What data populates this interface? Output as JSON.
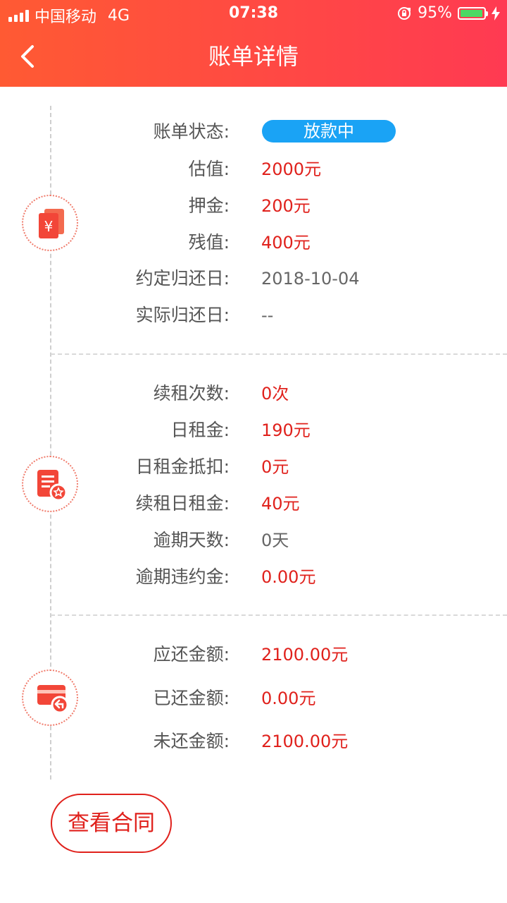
{
  "status_bar": {
    "carrier": "中国移动",
    "network": "4G",
    "time": "07:38",
    "battery_percent": "95%"
  },
  "nav": {
    "title": "账单详情",
    "back_icon": "chevron-left-icon"
  },
  "section1": {
    "icon": "yuan-bill-icon",
    "status_label": "账单状态:",
    "status_value": "放款中",
    "rows": [
      {
        "label": "估值:",
        "value": "2000元"
      },
      {
        "label": "押金:",
        "value": "200元"
      },
      {
        "label": "残值:",
        "value": "400元"
      },
      {
        "label": "约定归还日:",
        "value": "2018-10-04"
      },
      {
        "label": "实际归还日:",
        "value": "--"
      }
    ]
  },
  "section2": {
    "icon": "document-badge-icon",
    "rows": [
      {
        "label": "续租次数:",
        "value": "0次"
      },
      {
        "label": "日租金:",
        "value": "190元"
      },
      {
        "label": "日租金抵扣:",
        "value": "0元"
      },
      {
        "label": "续租日租金:",
        "value": "40元"
      },
      {
        "label": "逾期天数:",
        "value": "0天"
      },
      {
        "label": "逾期违约金:",
        "value": "0.00元"
      }
    ]
  },
  "section3": {
    "icon": "card-return-icon",
    "rows": [
      {
        "label": "应还金额:",
        "value": "2100.00元"
      },
      {
        "label": "已还金额:",
        "value": "0.00元"
      },
      {
        "label": "未还金额:",
        "value": "2100.00元"
      }
    ]
  },
  "actions": {
    "view_contract": "查看合同"
  },
  "colors": {
    "header_start": "#ff5a33",
    "header_end": "#ff3a52",
    "accent_red": "#e0211c",
    "badge_blue": "#1aa3f5",
    "battery_green": "#4cd964"
  }
}
